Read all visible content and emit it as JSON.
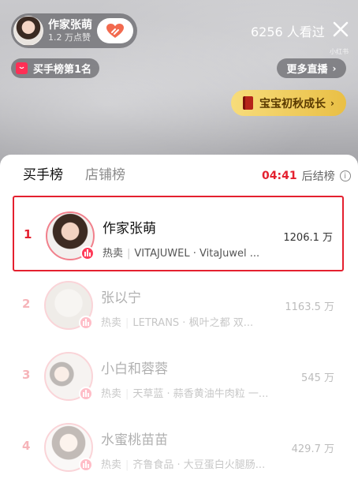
{
  "header": {
    "anchor_name": "作家张萌",
    "anchor_likes": "1.2 万点赞",
    "viewers": "6256 人看过",
    "id_tag": "小红书",
    "rank_badge": "买手榜第1名",
    "more_live": "更多直播",
    "promo": "宝宝初秋成长"
  },
  "panel": {
    "tabs": [
      {
        "label": "买手榜"
      },
      {
        "label": "店铺榜"
      }
    ],
    "countdown_time": "04:41",
    "countdown_label": "后结榜",
    "info_glyph": "i"
  },
  "rankings": [
    {
      "rank": "1",
      "name": "作家张萌",
      "hot": "热卖",
      "items": "VITAJUWEL · VitaJuwel ...",
      "amount": "1206.1 万"
    },
    {
      "rank": "2",
      "name": "张以宁",
      "hot": "热卖",
      "items": "LETRANS · 枫叶之都 双...",
      "amount": "1163.5 万"
    },
    {
      "rank": "3",
      "name": "小白和蓉蓉",
      "hot": "热卖",
      "items": "天草蓝 · 蒜香黄油牛肉粒 一...",
      "amount": "545 万"
    },
    {
      "rank": "4",
      "name": "水蜜桃苗苗",
      "hot": "热卖",
      "items": "齐鲁食品 · 大豆蛋白火腿肠...",
      "amount": "429.7 万"
    }
  ],
  "colors": {
    "accent_red": "#e4202f",
    "live_badge": "#ff3b59",
    "promo_gold": "#e9bf45"
  }
}
